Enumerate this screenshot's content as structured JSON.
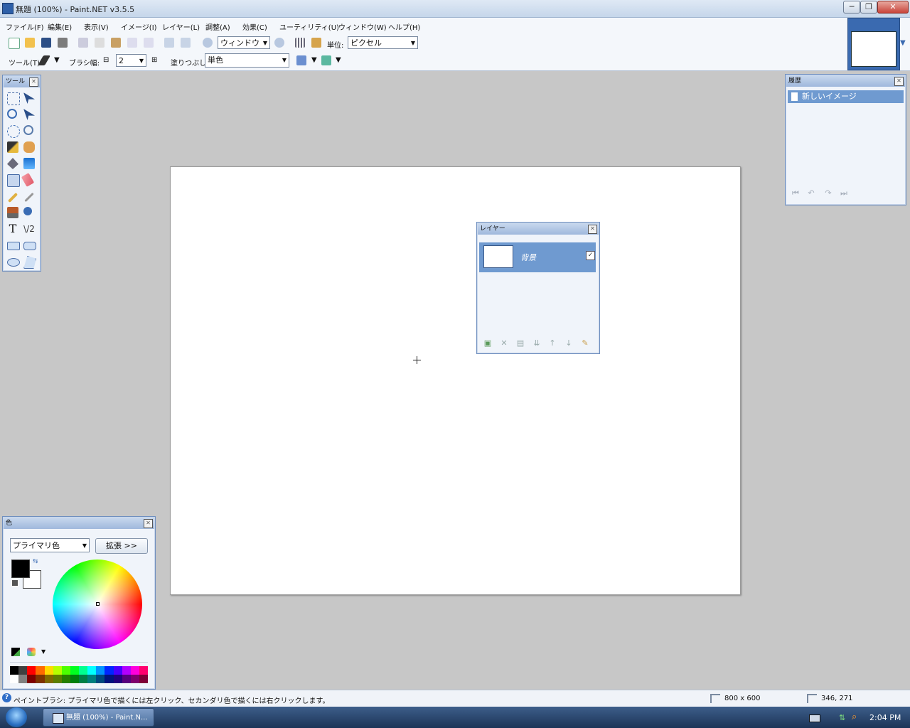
{
  "window": {
    "title": "無題 (100%) - Paint.NET v3.5.5",
    "min": "─",
    "max": "❐",
    "close": "✕"
  },
  "menu": [
    "ファイル(F)",
    "編集(E)",
    "表示(V)",
    "イメージ(I)",
    "レイヤー(L)",
    "調整(A)",
    "効果(C)",
    "ユーティリティ(U)",
    "ウィンドウ(W)",
    "ヘルプ(H)"
  ],
  "toolbar": {
    "zoom_value": "ウィンドウ",
    "unit_label": "単位:",
    "unit_value": "ピクセル",
    "tool_label": "ツール(T):",
    "brush_width_label": "ブラシ幅:",
    "brush_width_value": "2",
    "fill_label": "塗りつぶし:",
    "fill_value": "単色"
  },
  "tools_panel": {
    "title": "ツール"
  },
  "layers_panel": {
    "title": "レイヤー",
    "layer_name": "背景",
    "checked": "✓"
  },
  "history_panel": {
    "title": "履歴",
    "item": "新しいイメージ"
  },
  "colors_panel": {
    "title": "色",
    "mode": "プライマリ色",
    "more": "拡張 >>",
    "primary": "#000000",
    "secondary": "#ffffff"
  },
  "status": {
    "hint": "ペイントブラシ: プライマリ色で描くには左クリック、セカンダリ色で描くには右クリックします。",
    "image_size": "800 x 600",
    "cursor_pos": "346, 271"
  },
  "taskbar": {
    "task": "無題 (100%) - Paint.N...",
    "clock": "2:04 PM"
  }
}
